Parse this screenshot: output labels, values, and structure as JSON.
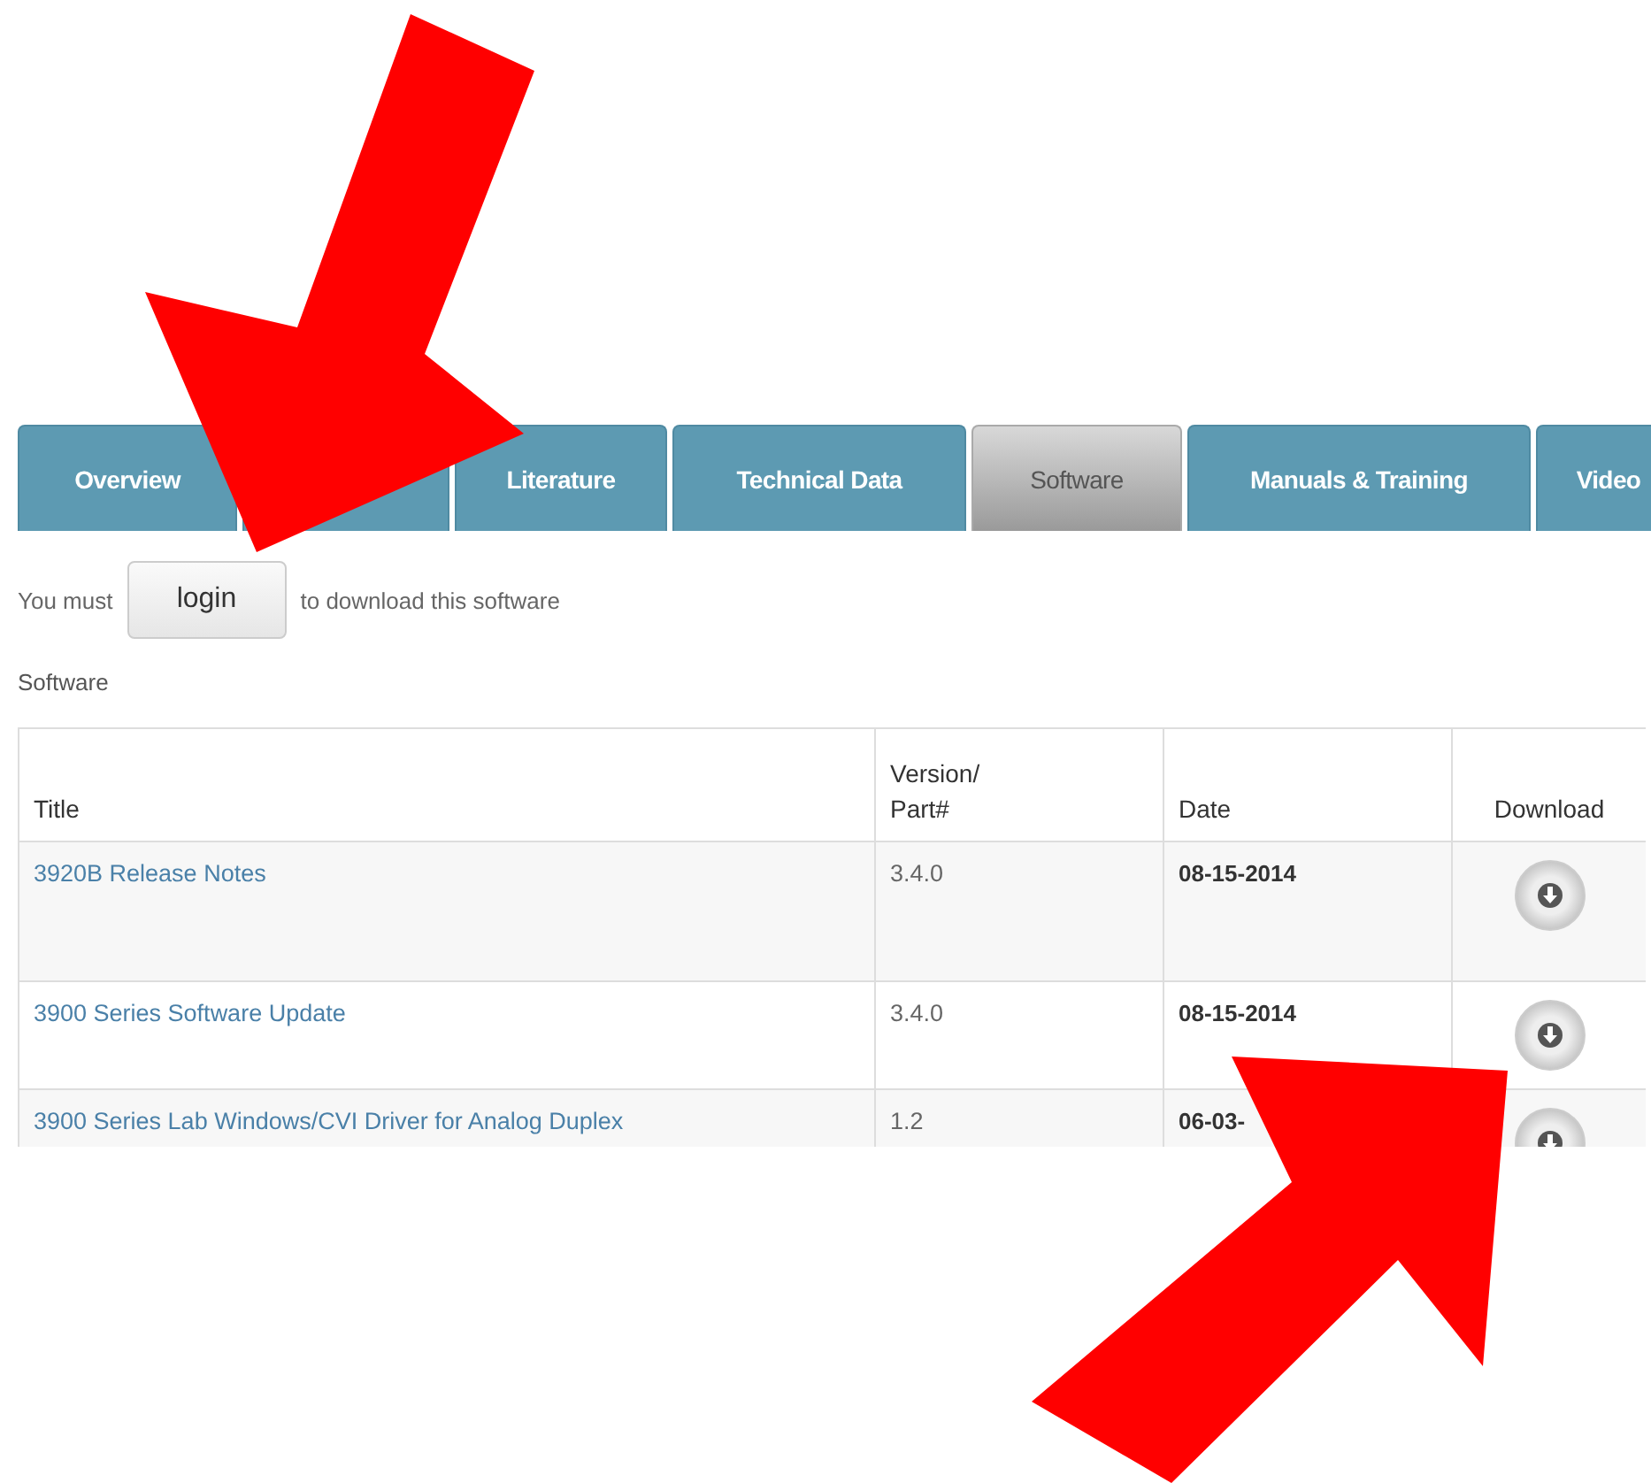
{
  "tabs": [
    {
      "label": "Overview",
      "selected": false
    },
    {
      "selected": false
    },
    {
      "label": "Literature",
      "selected": false
    },
    {
      "label": "Technical Data",
      "selected": false
    },
    {
      "label": "Software",
      "selected": true
    },
    {
      "label": "Manuals & Training",
      "selected": false
    },
    {
      "label": "Video",
      "selected": false
    }
  ],
  "login_notice": {
    "before": "You must",
    "button": "login",
    "after": "to download this software"
  },
  "section_title": "Software",
  "table": {
    "columns": [
      "Title",
      "Version/\nPart#",
      "Date",
      "Download"
    ],
    "rows": [
      {
        "title": "3920B Release Notes",
        "version": "3.4.0",
        "date": "08-15-2014"
      },
      {
        "title": "3900 Series Software Update",
        "version": "3.4.0",
        "date": "08-15-2014"
      },
      {
        "title": "3900 Series Lab Windows/CVI Driver for Analog Duplex",
        "version": "1.2",
        "date": "06-03-"
      }
    ]
  }
}
